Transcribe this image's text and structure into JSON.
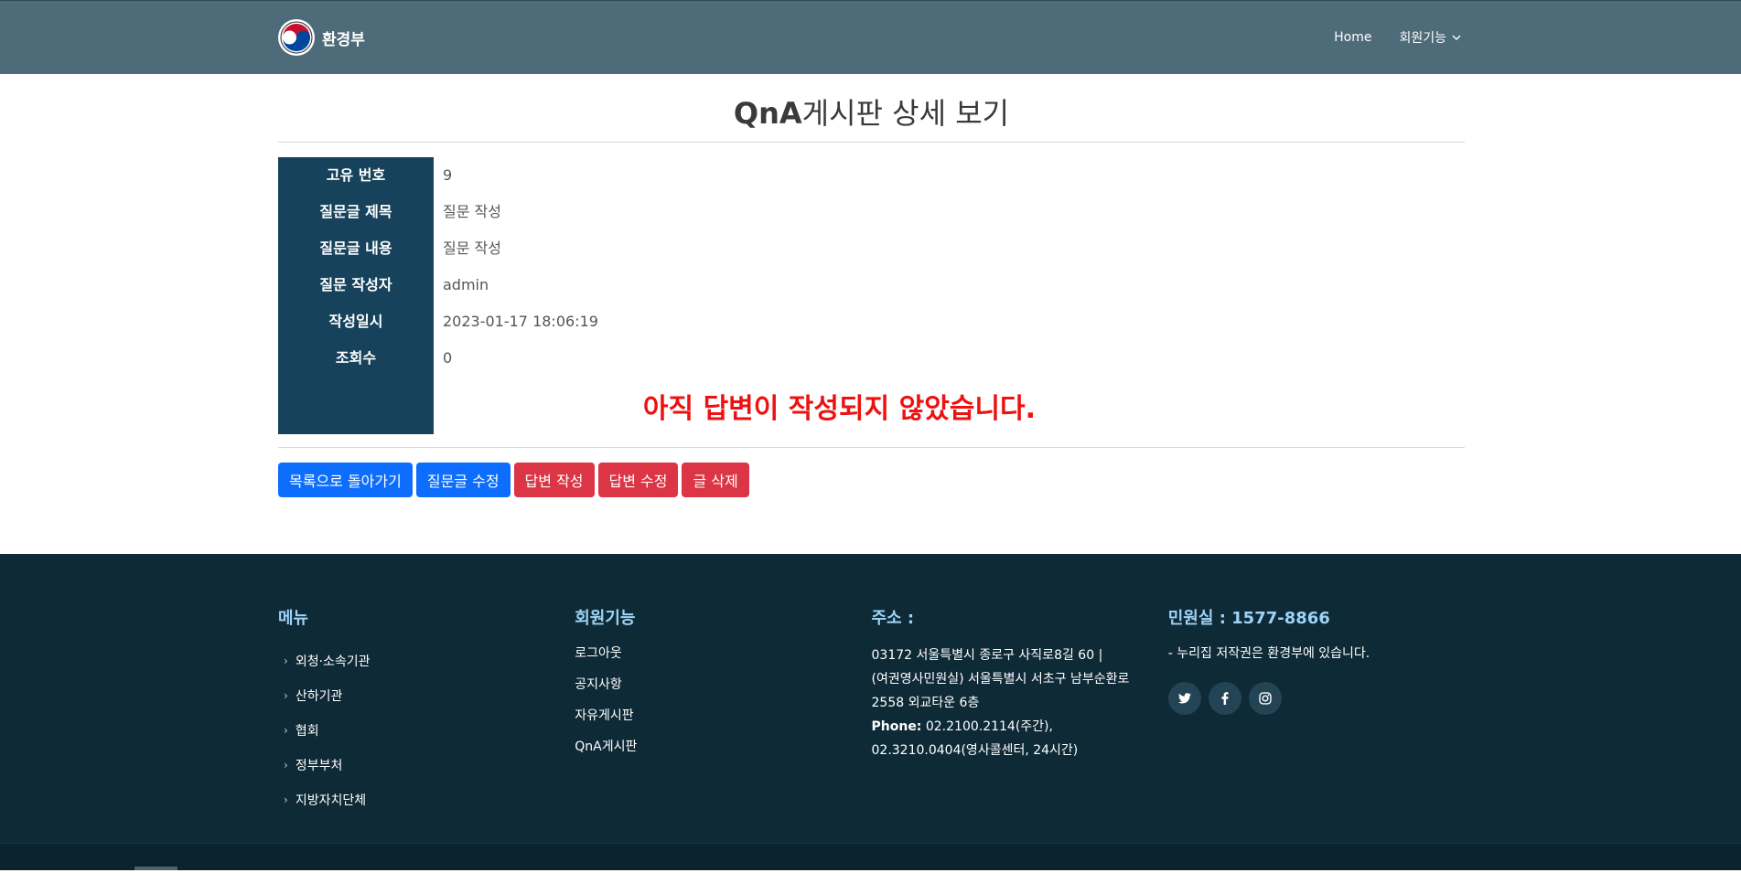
{
  "header": {
    "logo_text": "환경부",
    "nav": [
      {
        "label": "Home"
      },
      {
        "label": "회원기능"
      }
    ]
  },
  "page": {
    "title_bold": "QnA",
    "title_rest": "게시판 상세 보기"
  },
  "detail": {
    "rows": [
      {
        "label": "고유 번호",
        "value": "9"
      },
      {
        "label": "질문글 제목",
        "value": "질문 작성"
      },
      {
        "label": "질문글 내용",
        "value": "질문 작성"
      },
      {
        "label": "질문 작성자",
        "value": "admin"
      },
      {
        "label": "작성일시",
        "value": "2023-01-17 18:06:19"
      },
      {
        "label": "조회수",
        "value": "0"
      }
    ],
    "no_answer_text": "아직 답변이 작성되지 않았습니다."
  },
  "buttons": {
    "back_to_list": "목록으로 돌아가기",
    "edit_question": "질문글 수정",
    "write_answer": "답변 작성",
    "edit_answer": "답변 수정",
    "delete_post": "글 삭제"
  },
  "colors": {
    "header_bg": "#4e6b7a",
    "label_bg": "#16425b",
    "primary": "#0d6efd",
    "danger": "#dc3545",
    "alert_text": "#ee1111",
    "footer_bg": "#0f2a37",
    "footer_heading": "#9fd3f5"
  },
  "footer": {
    "menu": {
      "title": "메뉴",
      "items": [
        "외청·소속기관",
        "산하기관",
        "협회",
        "정부부처",
        "지방자치단체"
      ]
    },
    "members": {
      "title": "회원기능",
      "items": [
        "로그아웃",
        "공지사항",
        "자유게시판",
        "QnA게시판"
      ]
    },
    "address": {
      "title": "주소 :",
      "line1": "03172 서울특별시 종로구 사직로8길 60 |",
      "line2": "(여권영사민원실) 서울특별시 서초구 남부순환로",
      "line3": "2558 외교타운 6층",
      "phone_label": "Phone:",
      "phone_value": "02.2100.2114(주간),",
      "line5": "02.3210.0404(영사콜센터, 24시간)"
    },
    "cs": {
      "title": "민원실 : 1577-8866",
      "copyright": "- 누리집 저작권은 환경부에 있습니다.",
      "social": [
        {
          "icon": "twitter-icon"
        },
        {
          "icon": "facebook-icon"
        },
        {
          "icon": "instagram-icon"
        }
      ]
    }
  }
}
